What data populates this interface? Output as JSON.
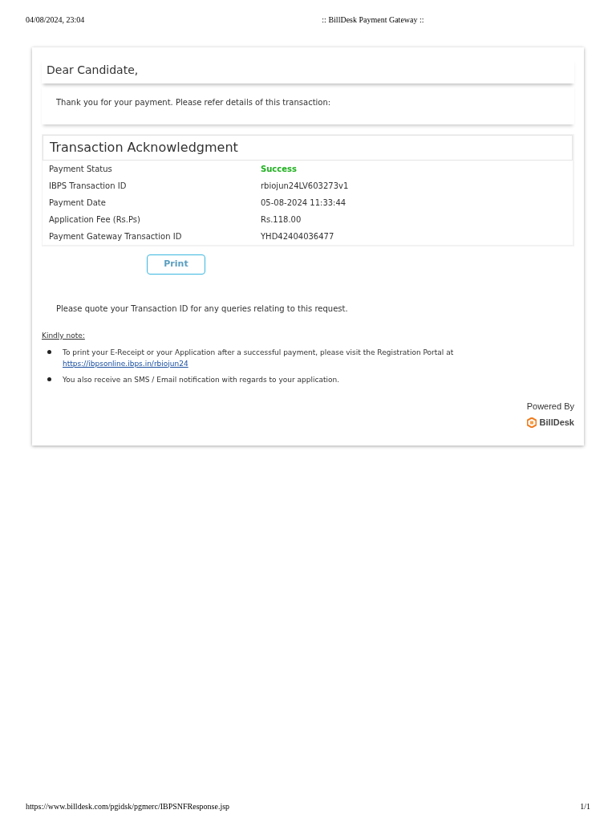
{
  "print_header": {
    "date": "04/08/2024, 23:04",
    "title": ":: BillDesk Payment Gateway ::"
  },
  "greeting": "Dear Candidate,",
  "intro": "Thank you for your payment. Please refer details of this transaction:",
  "acknowledgment": {
    "title": "Transaction Acknowledgment",
    "rows": [
      {
        "label": "Payment Status",
        "value": "Success",
        "kind": "status"
      },
      {
        "label": "IBPS Transaction ID",
        "value": "rbiojun24LV603273v1",
        "kind": "text"
      },
      {
        "label": "Payment Date",
        "value": "05-08-2024 11:33:44",
        "kind": "text"
      },
      {
        "label": "Application Fee (Rs.Ps)",
        "value": "Rs.118.00",
        "kind": "text"
      },
      {
        "label": "Payment Gateway Transaction ID",
        "value": "YHD42404036477",
        "kind": "text"
      }
    ]
  },
  "print_button": "Print",
  "quote_note": "Please quote your Transaction ID for any queries relating to this request.",
  "kindly_note": {
    "heading": "Kindly note:",
    "items": [
      {
        "text": "To print your E-Receipt or your Application after a successful payment, please visit the Registration Portal at",
        "link": "https://ibpsonline.ibps.in/rbiojun24"
      },
      {
        "text": "You also receive an SMS / Email notification with regards to your application."
      }
    ]
  },
  "powered_by": {
    "label": "Powered By",
    "brand": "BillDesk"
  },
  "print_footer": {
    "url": "https://www.billdesk.com/pgidsk/pgmerc/IBPSNFResponse.jsp",
    "page": "1/1"
  }
}
